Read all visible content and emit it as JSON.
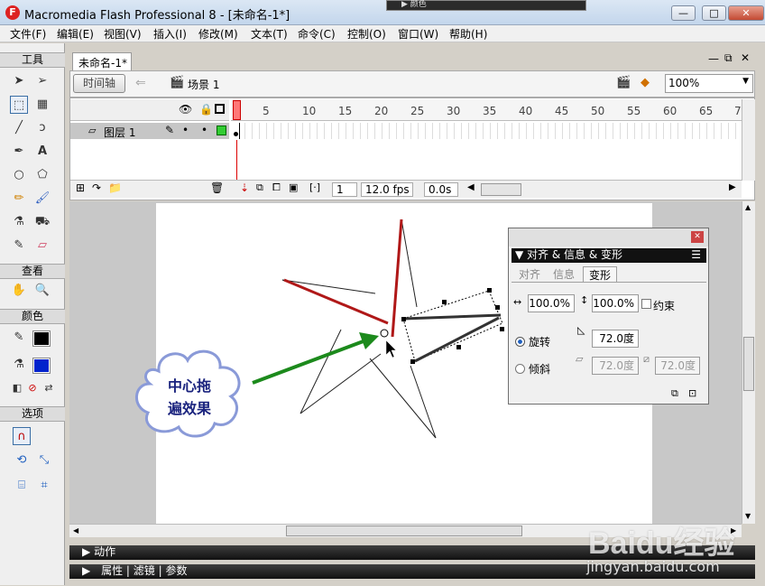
{
  "window": {
    "title": "Macromedia Flash Professional 8 - [未命名-1*]",
    "logo": "F",
    "min_glyph": "—",
    "max_glyph": "□",
    "close_glyph": "✕"
  },
  "top_popup": {
    "label": "▶ 颜色"
  },
  "menu": [
    "文件(F)",
    "编辑(E)",
    "视图(V)",
    "插入(I)",
    "修改(M)",
    "文本(T)",
    "命令(C)",
    "控制(O)",
    "窗口(W)",
    "帮助(H)"
  ],
  "toolbox": {
    "tools_label": "工具",
    "view_label": "查看",
    "colors_label": "颜色",
    "options_label": "选项"
  },
  "document": {
    "tab_title": "未命名-1*",
    "timeline_button": "时间轴",
    "scene_label": "场景 1",
    "zoom": "100%"
  },
  "timeline": {
    "layer_name": "图层 1",
    "frame_numbers": [
      "1",
      "5",
      "10",
      "15",
      "20",
      "25",
      "30",
      "35",
      "40",
      "45",
      "50",
      "55",
      "60",
      "65",
      "7"
    ],
    "current_frame": "1",
    "fps": "12.0 fps",
    "time": "0.0s"
  },
  "panel": {
    "title": "对齐 & 信息 & 变形",
    "tabs": [
      "对齐",
      "信息",
      "变形"
    ],
    "active_tab": "变形",
    "width_value": "100.0%",
    "height_value": "100.0%",
    "constrain_label": "约束",
    "rotate_label": "旋转",
    "rotate_value": "72.0度",
    "skew_label": "倾斜",
    "skew_h_value": "72.0度",
    "skew_v_value": "72.0度"
  },
  "callout": {
    "line1": "中心拖",
    "line2": "遍效果"
  },
  "bottom_panels": {
    "actions": "动作",
    "properties": "属性",
    "filters": "滤镜",
    "params": "参数"
  },
  "watermark": {
    "brand": "Baidu经验",
    "url": "jingyan.baidu.com"
  },
  "colors": {
    "accent_red": "#b01818",
    "arrow_green": "#1c8a1c",
    "callout_text": "#1a237e"
  }
}
